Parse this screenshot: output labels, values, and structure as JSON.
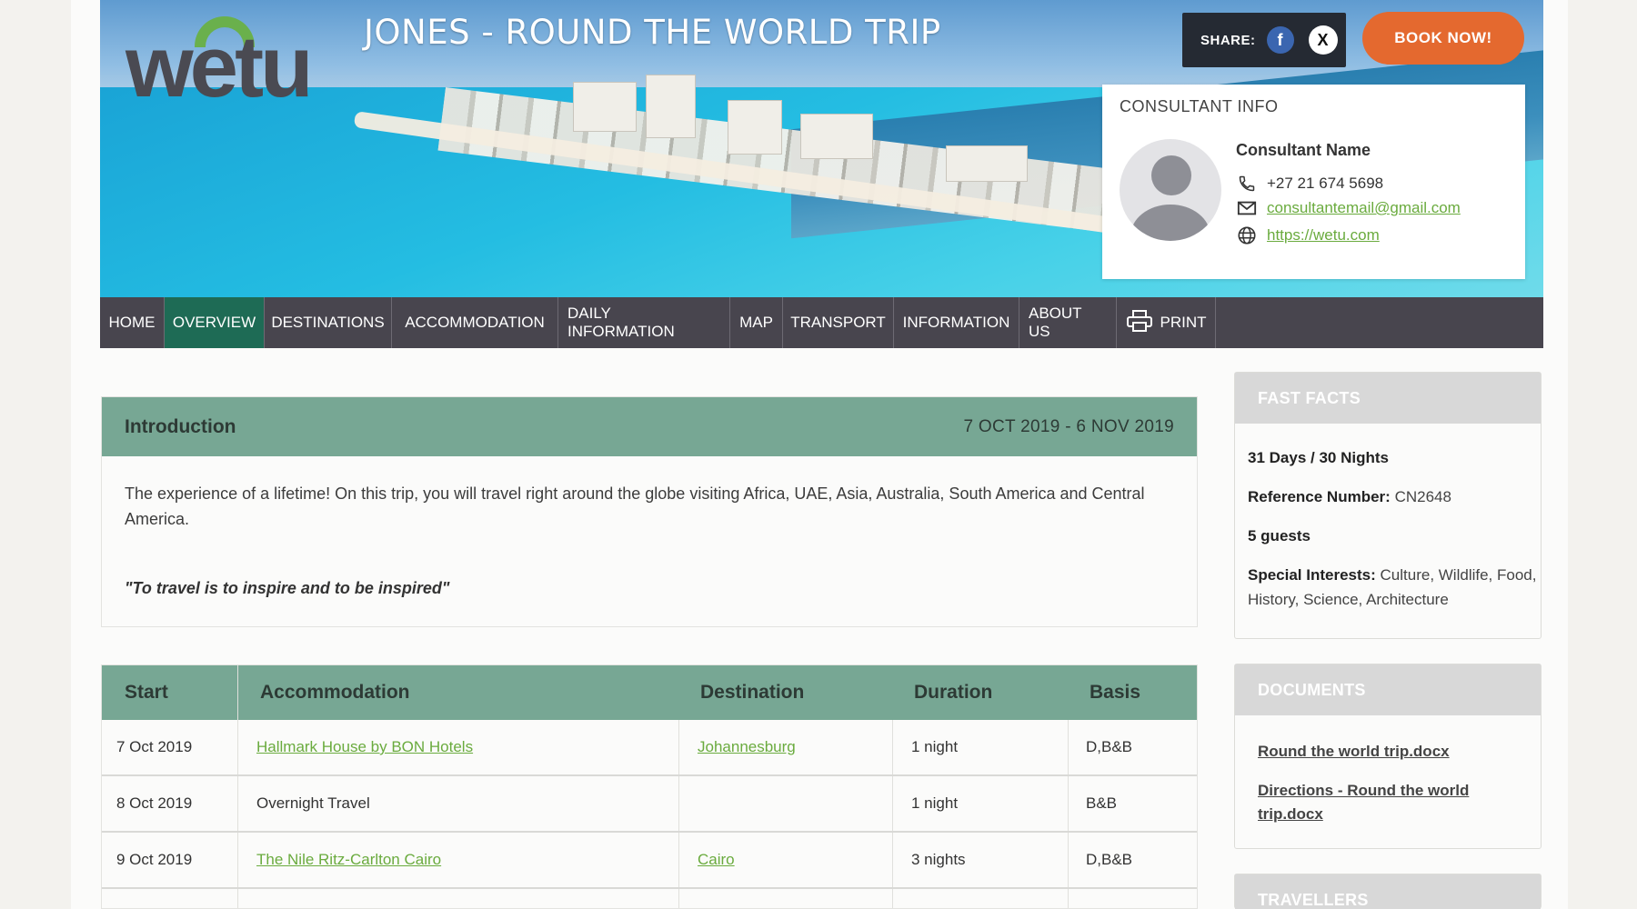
{
  "brand": {
    "logo_text": "wetu"
  },
  "trip": {
    "title": "JONES - ROUND THE WORLD TRIP"
  },
  "share": {
    "label": "SHARE:",
    "facebook_glyph": "f",
    "x_glyph": "X"
  },
  "book_button": "BOOK NOW!",
  "consultant": {
    "heading": "CONSULTANT INFO",
    "name": "Consultant Name",
    "phone": "+27 21 674 5698",
    "email": "consultantemail@gmail.com",
    "website": "https://wetu.com"
  },
  "nav": {
    "items": [
      "HOME",
      "OVERVIEW",
      "DESTINATIONS",
      "ACCOMMODATION",
      "DAILY INFORMATION",
      "MAP",
      "TRANSPORT",
      "INFORMATION",
      "ABOUT US",
      "PRINT"
    ],
    "active": "OVERVIEW"
  },
  "intro": {
    "title": "Introduction",
    "dates": "7 OCT 2019 - 6 NOV 2019",
    "description": "The experience of a lifetime! On this trip, you will travel right around the globe visiting Africa, UAE, Asia, Australia, South America and Central America.",
    "quote": "\"To travel is to inspire and to be inspired\""
  },
  "itinerary": {
    "columns": [
      "Start",
      "Accommodation",
      "Destination",
      "Duration",
      "Basis"
    ],
    "rows": [
      {
        "start": "7 Oct 2019",
        "accommodation": "Hallmark House by BON Hotels",
        "destination": "Johannesburg",
        "duration": "1 night",
        "basis": "D,B&B"
      },
      {
        "start": "8 Oct 2019",
        "accommodation": "Overnight Travel",
        "destination": "",
        "duration": "1 night",
        "basis": "B&B"
      },
      {
        "start": "9 Oct 2019",
        "accommodation": "The Nile Ritz-Carlton Cairo",
        "destination": "Cairo",
        "duration": "3 nights",
        "basis": "D,B&B"
      }
    ]
  },
  "fast_facts": {
    "heading": "FAST FACTS",
    "days_nights": "31 Days / 30 Nights",
    "reference_label": "Reference Number:",
    "reference_value": "CN2648",
    "guests": "5 guests",
    "interests_label": "Special Interests:",
    "interests_value": "Culture, Wildlife, Food, History, Science, Architecture"
  },
  "documents": {
    "heading": "DOCUMENTS",
    "files": [
      "Round the world trip.docx",
      "Directions - Round the world trip.docx"
    ]
  },
  "travellers": {
    "heading": "TRAVELLERS"
  },
  "colors": {
    "accent_green": "#77a794",
    "nav_bg": "#48454e",
    "nav_active": "#1e6b55",
    "book_orange": "#e4692f",
    "link_green": "#6aab3e"
  }
}
